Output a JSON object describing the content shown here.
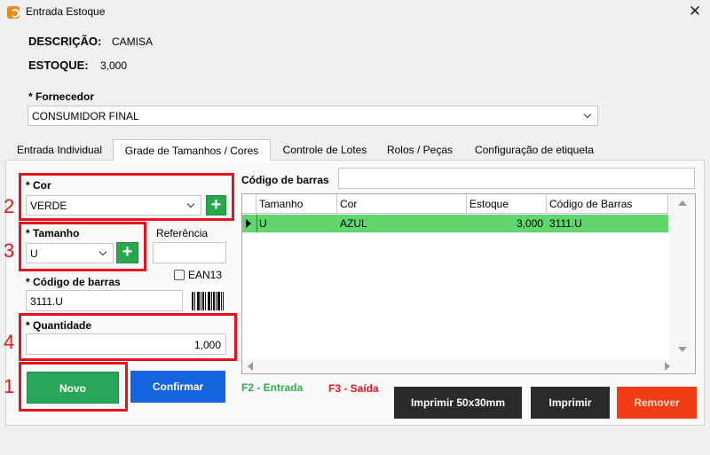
{
  "window": {
    "title": "Entrada Estoque",
    "close_symbol": "✕"
  },
  "product": {
    "desc_label": "DESCRIÇÃO:",
    "desc_value": "CAMISA",
    "stock_label": "ESTOQUE:",
    "stock_value": "3,000"
  },
  "supplier": {
    "label": "* Fornecedor",
    "value": "CONSUMIDOR FINAL"
  },
  "tabs": [
    {
      "label": "Entrada Individual"
    },
    {
      "label": "Grade de Tamanhos / Cores"
    },
    {
      "label": "Controle de Lotes"
    },
    {
      "label": "Rolos / Peças"
    },
    {
      "label": "Configuração de etiqueta"
    }
  ],
  "form": {
    "color_label": "* Cor",
    "color_value": "VERDE",
    "size_label": "* Tamanho",
    "size_value": "U",
    "reference_label": "Referência",
    "reference_value": "",
    "ean13_label": "EAN13",
    "barcode_label": "* Código de barras",
    "barcode_value": "3111.U",
    "qty_label": "* Quantidade",
    "qty_value": "1,000",
    "plus_symbol": "+"
  },
  "annotations": [
    "1",
    "2",
    "3",
    "4"
  ],
  "buttons": {
    "novo": "Novo",
    "confirmar": "Confirmar",
    "print_50x30": "Imprimir 50x30mm",
    "print": "Imprimir",
    "remove": "Remover"
  },
  "hints": {
    "f2": "F2 - Entrada",
    "f3": "F3 - Saída"
  },
  "grid_search": {
    "label": "Código de barras",
    "value": ""
  },
  "grid": {
    "columns": [
      "Tamanho",
      "Cor",
      "Estoque",
      "Código de Barras"
    ],
    "rows": [
      {
        "selected": true,
        "cells": [
          "U",
          "AZUL",
          "3,000",
          "3111.U"
        ]
      }
    ]
  },
  "colors": {
    "annotation_red": "#e8141c",
    "novo_green": "#28a65a",
    "confirm_blue": "#1464e0",
    "remove_red": "#f03c14",
    "print_dark": "#2a2a2a",
    "row_selected_green": "#5fd66e",
    "f2_green": "#2fb14a",
    "f3_red": "#e8141c"
  }
}
